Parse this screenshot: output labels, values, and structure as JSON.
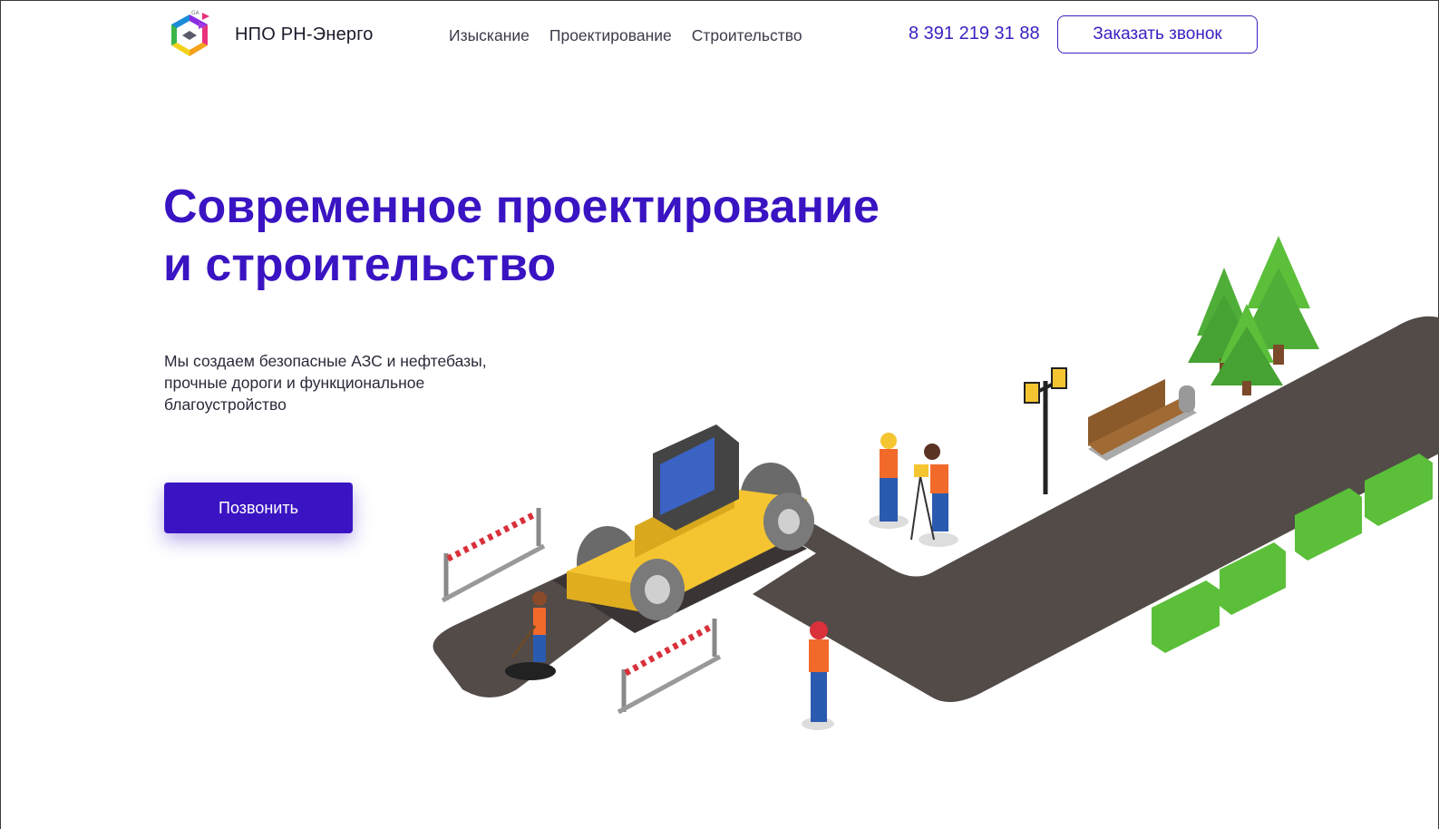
{
  "header": {
    "brand": "НПО РН-Энерго",
    "nav": [
      {
        "label": "Изыскание"
      },
      {
        "label": "Проектирование"
      },
      {
        "label": "Строительство"
      }
    ],
    "phone": "8 391 219 31 88",
    "callback_label": "Заказать звонок"
  },
  "hero": {
    "title_line1": "Современное проектирование",
    "title_line2": "и строительство",
    "subtitle": "Мы создаем безопасные АЗС и нефтебазы, прочные дороги и функциональное благоустройство",
    "cta_label": "Позвонить"
  },
  "colors": {
    "accent": "#3a14c2",
    "road": "#524b48",
    "machine": "#f5c531",
    "foliage": "#5bbf3a"
  },
  "icons": [
    "logo-icon"
  ]
}
